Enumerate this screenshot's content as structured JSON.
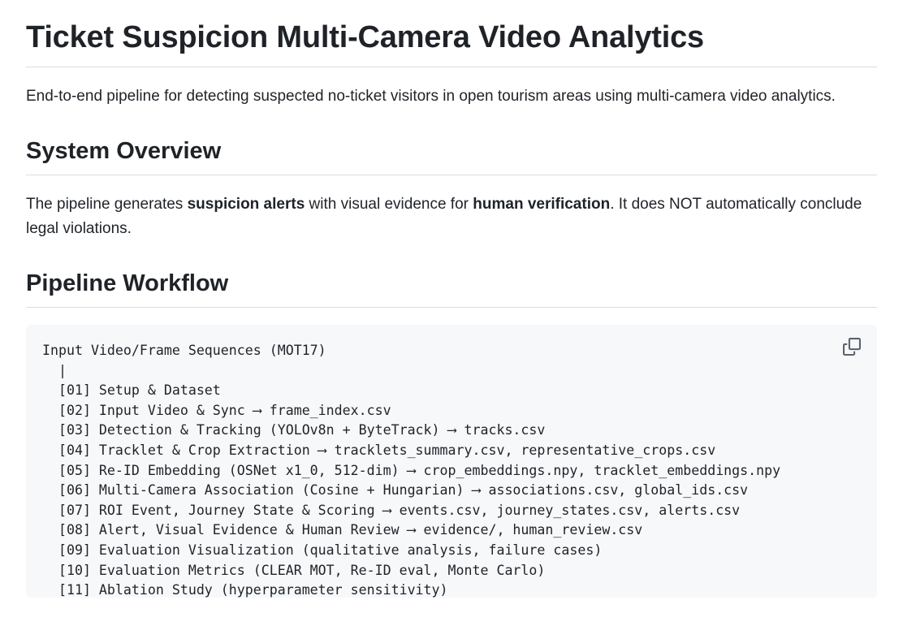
{
  "title": "Ticket Suspicion Multi-Camera Video Analytics",
  "intro": "End-to-end pipeline for detecting suspected no-ticket visitors in open tourism areas using multi-camera video analytics.",
  "overview": {
    "heading": "System Overview",
    "text_part1": "The pipeline generates ",
    "bold1": "suspicion alerts",
    "text_part2": " with visual evidence for ",
    "bold2": "human verification",
    "text_part3": ". It does NOT automatically conclude legal violations."
  },
  "workflow": {
    "heading": "Pipeline Workflow",
    "code_lines": [
      "Input Video/Frame Sequences (MOT17)",
      "  |",
      "  [01] Setup & Dataset",
      "  [02] Input Video & Sync ⟶ frame_index.csv",
      "  [03] Detection & Tracking (YOLOv8n + ByteTrack) ⟶ tracks.csv",
      "  [04] Tracklet & Crop Extraction ⟶ tracklets_summary.csv, representative_crops.csv",
      "  [05] Re-ID Embedding (OSNet x1_0, 512-dim) ⟶ crop_embeddings.npy, tracklet_embeddings.npy",
      "  [06] Multi-Camera Association (Cosine + Hungarian) ⟶ associations.csv, global_ids.csv",
      "  [07] ROI Event, Journey State & Scoring ⟶ events.csv, journey_states.csv, alerts.csv",
      "  [08] Alert, Visual Evidence & Human Review ⟶ evidence/, human_review.csv",
      "  [09] Evaluation Visualization (qualitative analysis, failure cases)",
      "  [10] Evaluation Metrics (CLEAR MOT, Re-ID eval, Monte Carlo)",
      "  [11] Ablation Study (hyperparameter sensitivity)"
    ],
    "copy_icon": "copy-icon"
  }
}
